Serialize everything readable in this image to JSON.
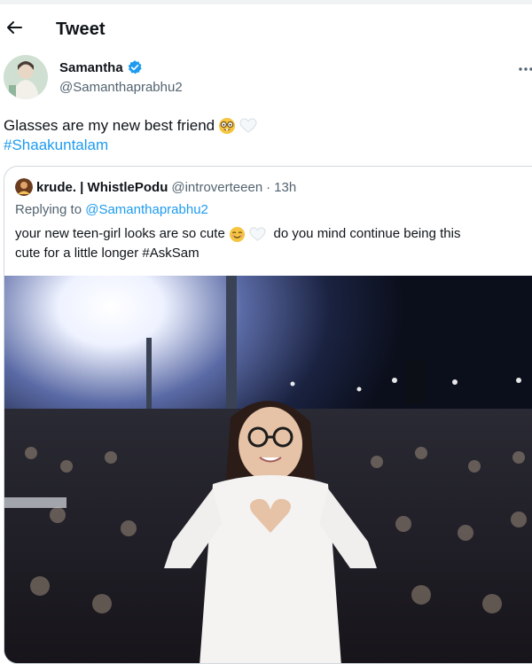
{
  "header": {
    "title": "Tweet"
  },
  "tweet": {
    "display_name": "Samantha",
    "handle": "@Samanthaprabhu2",
    "text": "Glasses are my new best friend",
    "hashtag": "#Shaakuntalam"
  },
  "quote": {
    "display_name": "krude. | WhistlePodu",
    "handle": "@introverteeen",
    "separator": "·",
    "time": "13h",
    "replying_prefix": "Replying to",
    "replying_to": "@Samanthaprabhu2",
    "text_part1": "your new teen-girl looks are so cute",
    "text_part2": "do you mind continue being this",
    "text_line2": "cute for a little longer #AskSam"
  },
  "icons": {
    "back": "arrow-left-icon",
    "verified": "verified-badge-icon",
    "more": "more-horizontal-icon",
    "nerd_emoji": "nerd-face-emoji-icon",
    "white_heart": "white-heart-emoji-icon",
    "smiling_emoji": "smiling-face-emoji-icon"
  },
  "colors": {
    "link": "#1d9bf0",
    "secondary_text": "#536471",
    "border": "#cfd9de"
  }
}
